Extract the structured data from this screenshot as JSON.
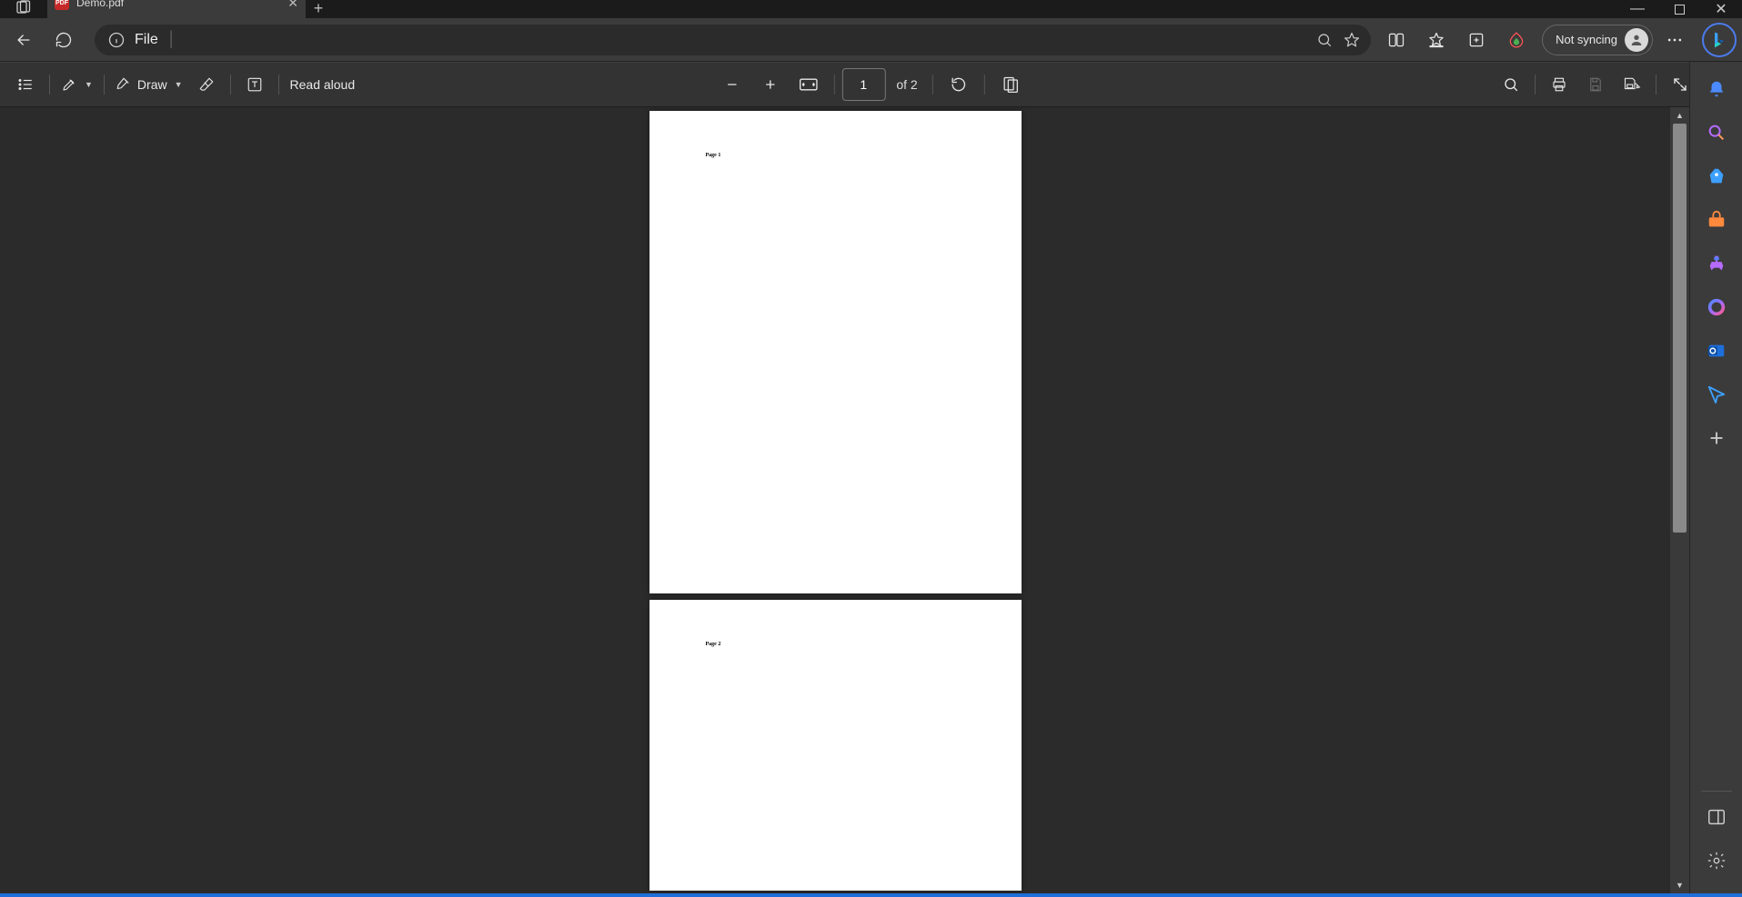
{
  "tab": {
    "title": "Demo.pdf",
    "favicon_label": "PDF"
  },
  "address": {
    "scheme": "File"
  },
  "sync": {
    "label": "Not syncing"
  },
  "pdf": {
    "draw_label": "Draw",
    "read_aloud_label": "Read aloud",
    "page_current": "1",
    "page_total_prefix": "of ",
    "page_total": "2",
    "pages": [
      {
        "text": "Page 1"
      },
      {
        "text": "Page 2"
      }
    ]
  },
  "icons": {
    "back": "back-icon",
    "refresh": "refresh-icon",
    "info": "info-icon",
    "search": "search-icon",
    "star": "star-icon",
    "split": "split-screen-icon",
    "favorites": "favorites-icon",
    "collections": "collections-icon",
    "perf": "performance-icon",
    "more": "more-icon",
    "bing": "bing-icon"
  }
}
